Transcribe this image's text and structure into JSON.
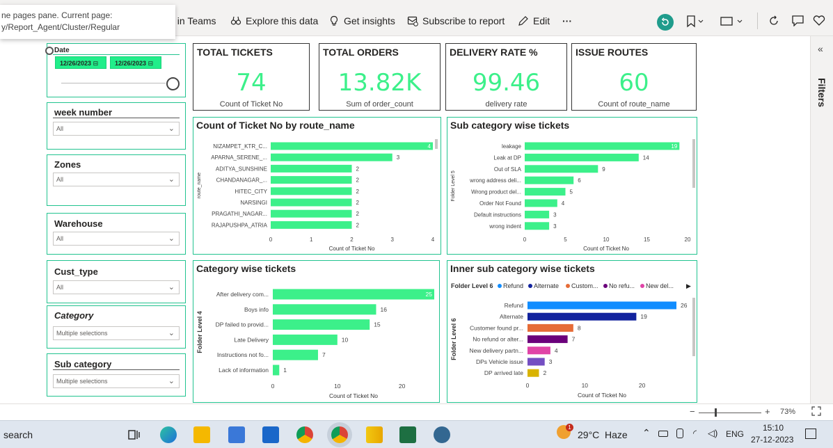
{
  "tooltip": {
    "line1": "ne pages pane. Current page:",
    "line2": "y/Report_Agent/Cluster/Regular"
  },
  "toolbar": {
    "teams": "t in Teams",
    "explore": "Explore this data",
    "insights": "Get insights",
    "subscribe": "Subscribe to report",
    "edit": "Edit",
    "more": "···"
  },
  "filters_pane": {
    "label": "Filters",
    "collapse": "«"
  },
  "slicers": {
    "date": {
      "title": "Date",
      "start": "12/26/2023",
      "end": "12/26/2023"
    },
    "week": {
      "title": "week number",
      "value": "All"
    },
    "zones": {
      "title": "Zones",
      "value": "All"
    },
    "warehouse": {
      "title": "Warehouse",
      "value": "All"
    },
    "cust_type": {
      "title": "Cust_type",
      "value": "All"
    },
    "category": {
      "title": "Category",
      "value": "Multiple selections"
    },
    "subcategory": {
      "title": "Sub category",
      "value": "Multiple selections"
    }
  },
  "cards": [
    {
      "title": "TOTAL TICKETS",
      "value": "74",
      "sub": "Count of Ticket No"
    },
    {
      "title": "TOTAL ORDERS",
      "value": "13.82K",
      "sub": "Sum of order_count"
    },
    {
      "title": "DELIVERY RATE %",
      "value": "99.46",
      "sub": "delivery rate"
    },
    {
      "title": "ISSUE ROUTES",
      "value": "60",
      "sub": "Count of route_name"
    }
  ],
  "colors": {
    "accent": "#21c38f",
    "bar": "#3cf08a",
    "kpi": "#3cf08a"
  },
  "chart_data": [
    {
      "type": "bar",
      "title": "Count of Ticket No by route_name",
      "xlabel": "Count of Ticket No",
      "ylabel": "route_name",
      "categories": [
        "NIZAMPET_KTR_C...",
        "APARNA_SERENE_...",
        "ADITYA_SUNSHINE",
        "CHANDANAGAR_...",
        "HITEC_CITY",
        "NARSINGI",
        "PRAGATHI_NAGAR...",
        "RAJAPUSHPA_ATRIA"
      ],
      "values": [
        4,
        3,
        2,
        2,
        2,
        2,
        2,
        2
      ],
      "xticks": [
        0,
        1,
        2,
        3,
        4
      ],
      "xlim": [
        0,
        4
      ]
    },
    {
      "type": "bar",
      "title": "Sub category wise tickets",
      "xlabel": "Count of Ticket No",
      "ylabel": "Folder Level 5",
      "categories": [
        "leakage",
        "Leak at DP",
        "Out of SLA",
        "wrong address deli...",
        "Wrong product del...",
        "Order Not Found",
        "Default instructions",
        "wrong indent"
      ],
      "values": [
        19,
        14,
        9,
        6,
        5,
        4,
        3,
        3
      ],
      "xticks": [
        0,
        5,
        10,
        15,
        20
      ],
      "xlim": [
        0,
        20
      ]
    },
    {
      "type": "bar",
      "title": "Category wise tickets",
      "xlabel": "Count of Ticket No",
      "ylabel": "Folder Level 4",
      "categories": [
        "After delivery com...",
        "Boys info",
        "DP failed to provid...",
        "Late Delivery",
        "Instructions not fo...",
        "Lack of information"
      ],
      "values": [
        25,
        16,
        15,
        10,
        7,
        1
      ],
      "xticks": [
        0,
        10,
        20
      ],
      "xlim": [
        0,
        25
      ]
    },
    {
      "type": "bar",
      "title": "Inner sub category wise tickets",
      "xlabel": "Count of Ticket No",
      "ylabel": "Folder Level 6",
      "legend_title": "Folder Level 6",
      "legend": [
        {
          "name": "Refund",
          "color": "#118dff"
        },
        {
          "name": "Alternate",
          "color": "#12239e"
        },
        {
          "name": "Custom...",
          "color": "#e66c37"
        },
        {
          "name": "No refu...",
          "color": "#6b007b"
        },
        {
          "name": "New del...",
          "color": "#e044a7"
        }
      ],
      "categories": [
        "Refund",
        "Alternate",
        "Customer found pr...",
        "No refund or alter...",
        "New delivery partn...",
        "DPs Vehicle issue",
        "DP arrived late"
      ],
      "values": [
        26,
        19,
        8,
        7,
        4,
        3,
        2
      ],
      "colors": [
        "#118dff",
        "#12239e",
        "#e66c37",
        "#6b007b",
        "#e044a7",
        "#744ec2",
        "#d9b300"
      ],
      "xticks": [
        0,
        10,
        20
      ],
      "xlim": [
        0,
        26
      ]
    }
  ],
  "statusbar": {
    "zoom": "73%",
    "minus": "−",
    "plus": "+"
  },
  "taskbar": {
    "search": "search",
    "weather_temp": "29°C",
    "weather_desc": "Haze",
    "lang": "ENG",
    "time": "15:10",
    "date": "27-12-2023",
    "weather_badge": "1"
  }
}
